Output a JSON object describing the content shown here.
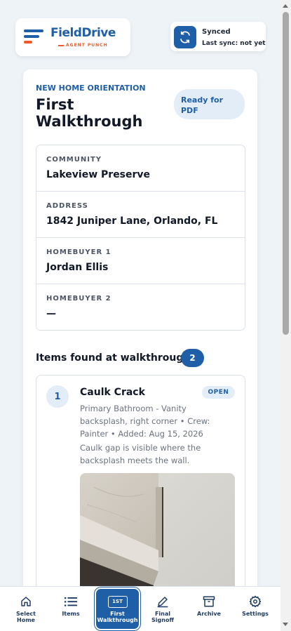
{
  "header": {
    "logo_name": "FieldDrive",
    "logo_tagline": "AGENT PUNCH",
    "sync_status": "Synced",
    "sync_detail": "Last sync: not yet"
  },
  "main": {
    "eyebrow": "NEW HOME ORIENTATION",
    "title": "First Walkthrough",
    "status": "Ready for PDF",
    "info": [
      {
        "label": "COMMUNITY",
        "value": "Lakeview Preserve"
      },
      {
        "label": "ADDRESS",
        "value": "1842 Juniper Lane, Orlando, FL"
      },
      {
        "label": "HOMEBUYER 1",
        "value": "Jordan Ellis"
      },
      {
        "label": "HOMEBUYER 2",
        "value": "—"
      }
    ],
    "items_heading": "Items found at walkthrough",
    "items_count": "2",
    "items": [
      {
        "number": "1",
        "title": "Caulk Crack",
        "status": "OPEN",
        "meta": "Primary Bathroom - Vanity backsplash, right corner • Crew: Painter • Added: Aug 15, 2026",
        "description": "Caulk gap is visible where the backsplash meets the wall."
      }
    ]
  },
  "nav": [
    {
      "label": "Select Home",
      "icon": "home-icon"
    },
    {
      "label": "Items",
      "icon": "list-icon"
    },
    {
      "label": "First Walkthrough",
      "icon": "first-badge-icon",
      "badge": "1ST",
      "active": true
    },
    {
      "label": "Final Signoff",
      "icon": "pen-icon"
    },
    {
      "label": "Archive",
      "icon": "archive-icon"
    },
    {
      "label": "Settings",
      "icon": "gear-icon"
    }
  ],
  "colors": {
    "brand": "#1f5fa8",
    "accent": "#f05a28",
    "background": "#eef3f8"
  }
}
